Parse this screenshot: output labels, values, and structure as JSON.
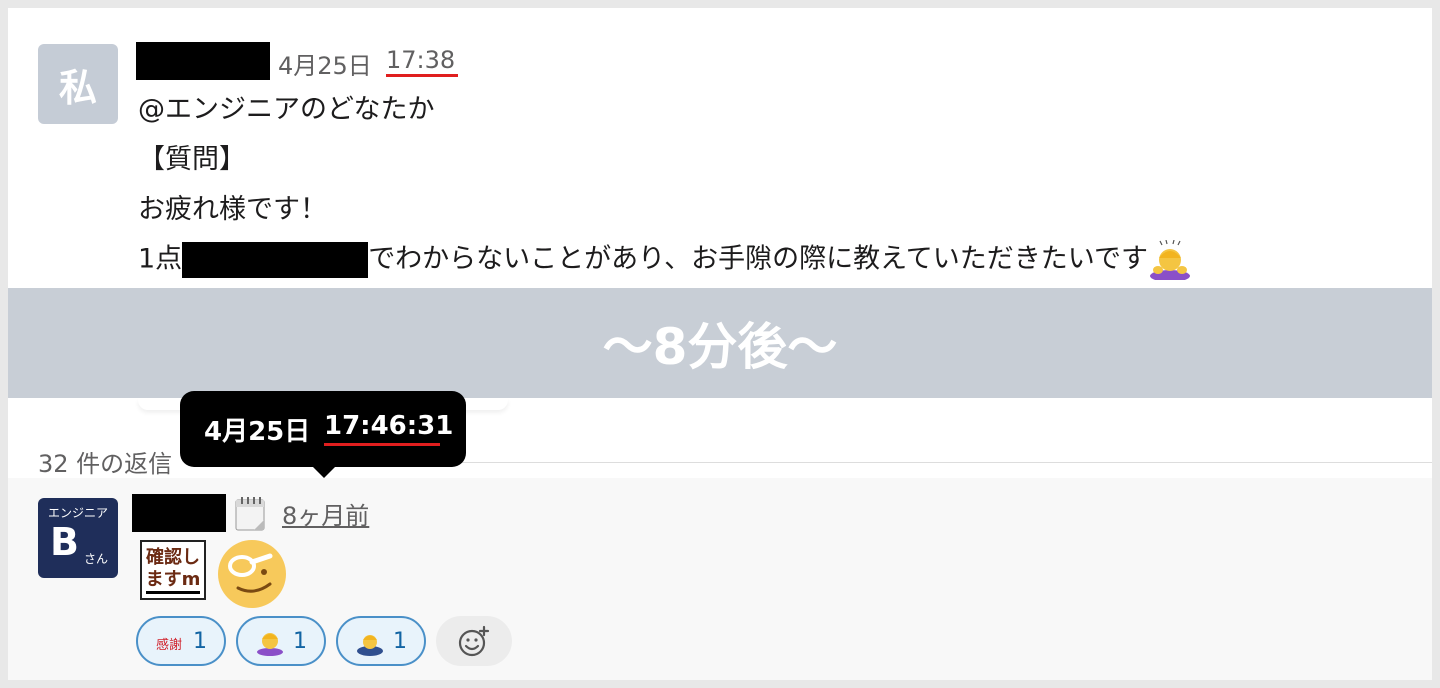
{
  "message": {
    "avatar_char": "私",
    "date": "4月25日",
    "time": "17:38",
    "lines": [
      "@エンジニアのどなたか",
      "【質問】",
      "お疲れ様です！"
    ],
    "line4_prefix": "1点",
    "line4_suffix": "でわからないことがあり、お手隙の際に教えていただきたいです",
    "line4_emoji_icon": "person-bowing-icon"
  },
  "band": {
    "text": "〜8分後〜"
  },
  "thread": {
    "replies_text": "32 件の返信"
  },
  "tooltip": {
    "date": "4月25日",
    "time": "17:46:31"
  },
  "reply": {
    "avatar_top": "エンジニア",
    "avatar_letter": "B",
    "avatar_suffix": "さん",
    "relative_time": "8ヶ月前",
    "stamp_line1": "確認し",
    "stamp_line2": "ますm",
    "big_emoji_icon": "monocle-face-icon",
    "reactions": [
      {
        "icon": "kansha-stamp-icon",
        "count": "1"
      },
      {
        "icon": "person-bowing-icon",
        "count": "1"
      },
      {
        "icon": "person-bowing-deep-icon",
        "count": "1"
      }
    ],
    "add_reaction_icon": "add-reaction-icon"
  },
  "colors": {
    "underline": "#e01e1e",
    "band": "#c8ced6",
    "reaction_border": "#4a90c8",
    "reaction_count": "#1264a3"
  }
}
